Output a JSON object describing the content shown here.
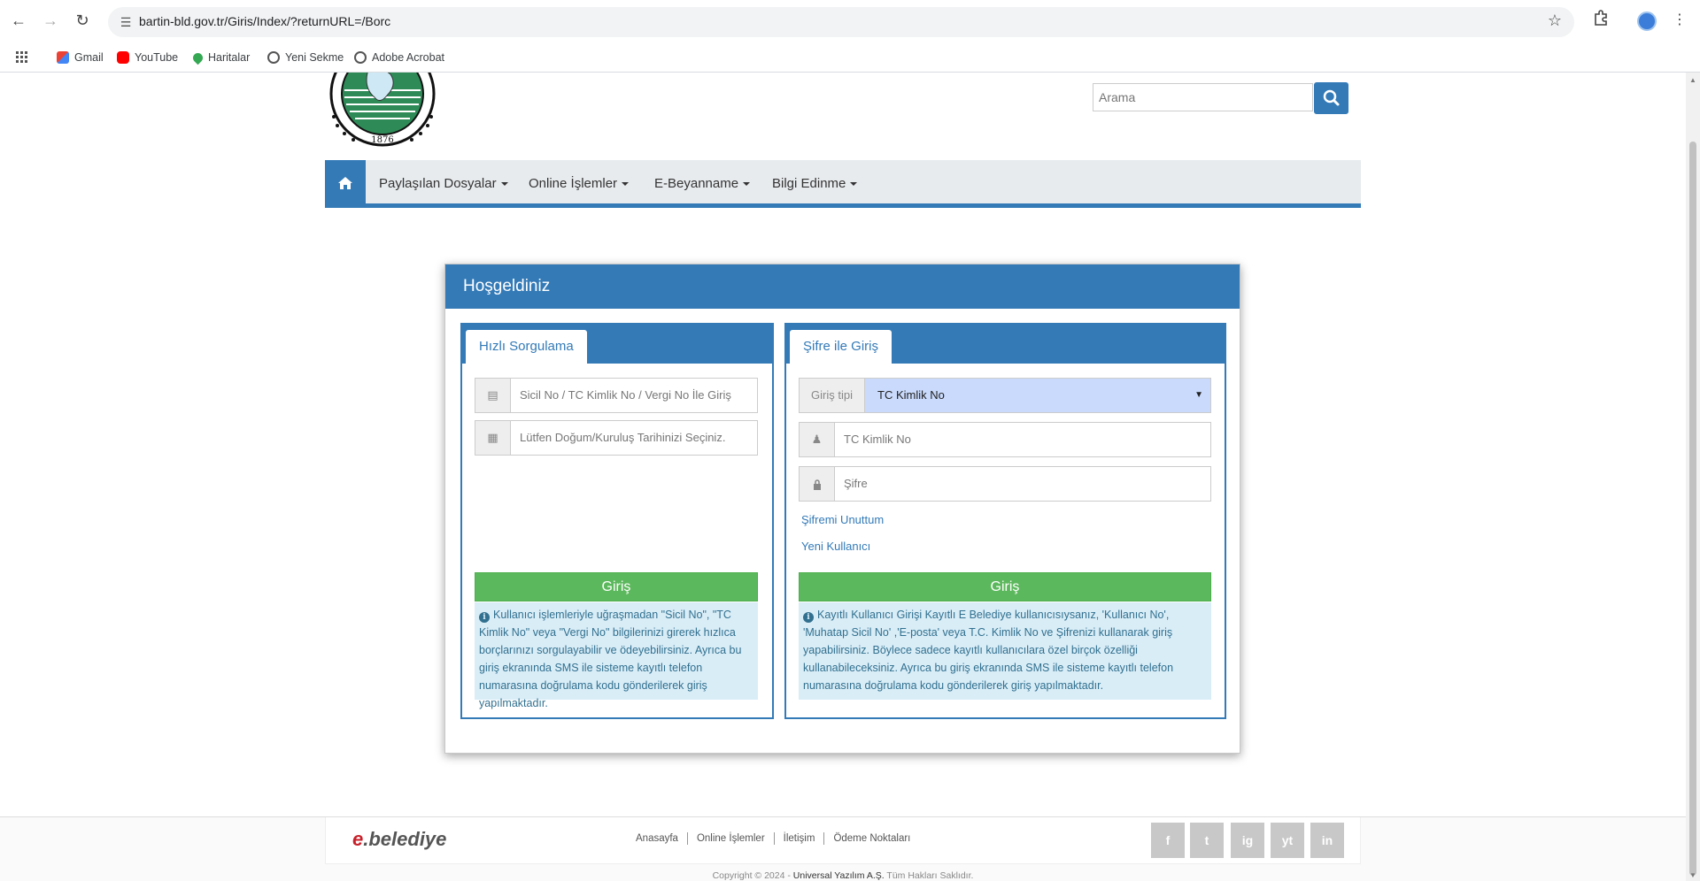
{
  "browser": {
    "url": "bartin-bld.gov.tr/Giris/Index/?returnURL=/Borc",
    "bookmarks": [
      "Gmail",
      "YouTube",
      "Haritalar",
      "Yeni Sekme",
      "Adobe Acrobat"
    ]
  },
  "header": {
    "logo_year": "1876",
    "search_placeholder": "Arama"
  },
  "menu": {
    "items": [
      "Paylaşılan Dosyalar",
      "Online İşlemler",
      "E-Beyanname",
      "Bilgi Edinme"
    ]
  },
  "card": {
    "title": "Hoşgeldiniz",
    "quick": {
      "tab": "Hızlı Sorgulama",
      "sicil_placeholder": "Sicil No / TC Kimlik No / Vergi No İle Giriş",
      "date_placeholder": "Lütfen Doğum/Kuruluş Tarihinizi Seçiniz.",
      "button": "Giriş",
      "info": "Kullanıcı işlemleriyle uğraşmadan \"Sicil No\", \"TC Kimlik No\" veya \"Vergi No\" bilgilerinizi girerek hızlıca borçlarınızı sorgulayabilir ve ödeyebilirsiniz. Ayrıca bu giriş ekranında SMS ile sisteme kayıtlı telefon numarasına doğrulama kodu gönderilerek giriş yapılmaktadır."
    },
    "login": {
      "tab": "Şifre ile Giriş",
      "type_label": "Giriş tipi",
      "type_value": "TC Kimlik No",
      "tc_placeholder": "TC Kimlik No",
      "password_placeholder": "Şifre",
      "forgot": "Şifremi Unuttum",
      "new_user": "Yeni Kullanıcı",
      "button": "Giriş",
      "info": "Kayıtlı Kullanıcı Girişi Kayıtlı E Belediye kullanıcısıysanız, 'Kullanıcı No', 'Muhatap Sicil No' ,'E-posta' veya T.C. Kimlik No ve Şifrenizi kullanarak giriş yapabilirsiniz. Böylece sadece kayıtlı kullanıcılara özel birçok özelliği kullanabileceksiniz. Ayrıca bu giriş ekranında SMS ile sisteme kayıtlı telefon numarasına doğrulama kodu gönderilerek giriş yapılmaktadır."
    }
  },
  "footer": {
    "brand_e": "e",
    "brand_rest": ".belediye",
    "links": [
      "Anasayfa",
      "Online İşlemler",
      "İletişim",
      "Ödeme Noktaları"
    ],
    "social": [
      "f",
      "t",
      "ig",
      "yt",
      "in"
    ],
    "copyright_prefix": "Copyright © 2024 - ",
    "copyright_company": "Universal Yazılım A.Ş.",
    "copyright_suffix": " Tüm Hakları Saklıdır."
  }
}
